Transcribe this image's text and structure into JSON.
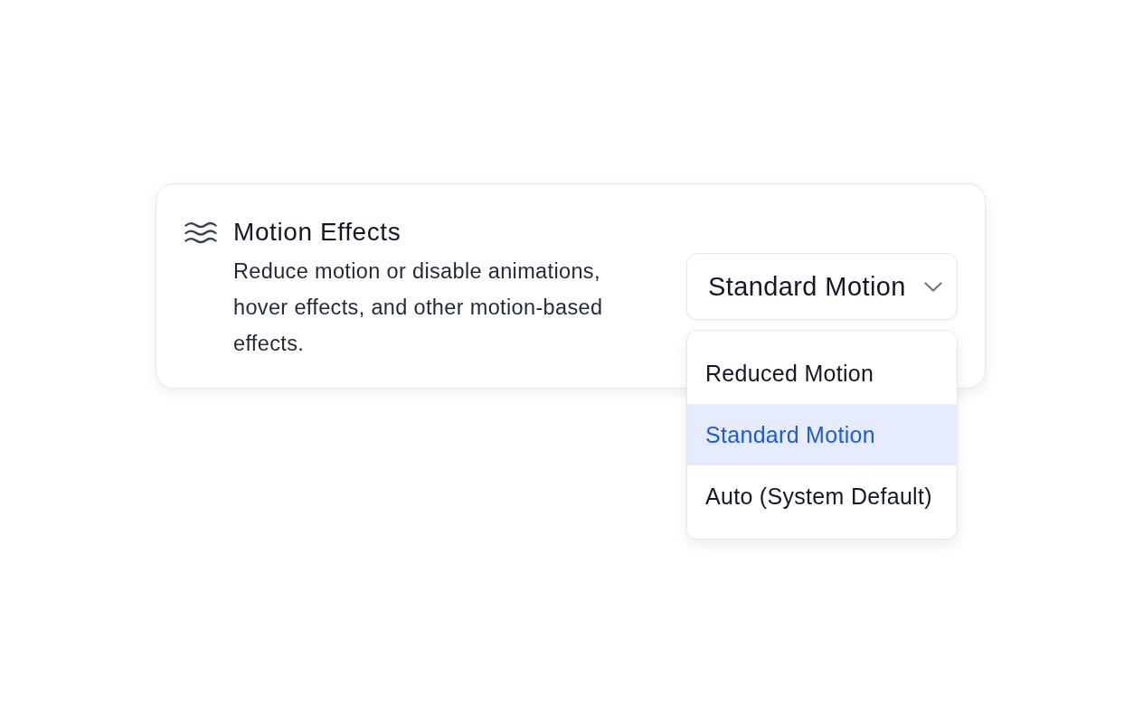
{
  "setting": {
    "title": "Motion Effects",
    "description": "Reduce motion or disable animations, hover effects, and other motion-based effects.",
    "select": {
      "value": "Standard Motion",
      "options": [
        {
          "label": "Reduced Motion",
          "selected": false
        },
        {
          "label": "Standard Motion",
          "selected": true
        },
        {
          "label": "Auto (System Default)",
          "selected": false
        }
      ]
    }
  }
}
